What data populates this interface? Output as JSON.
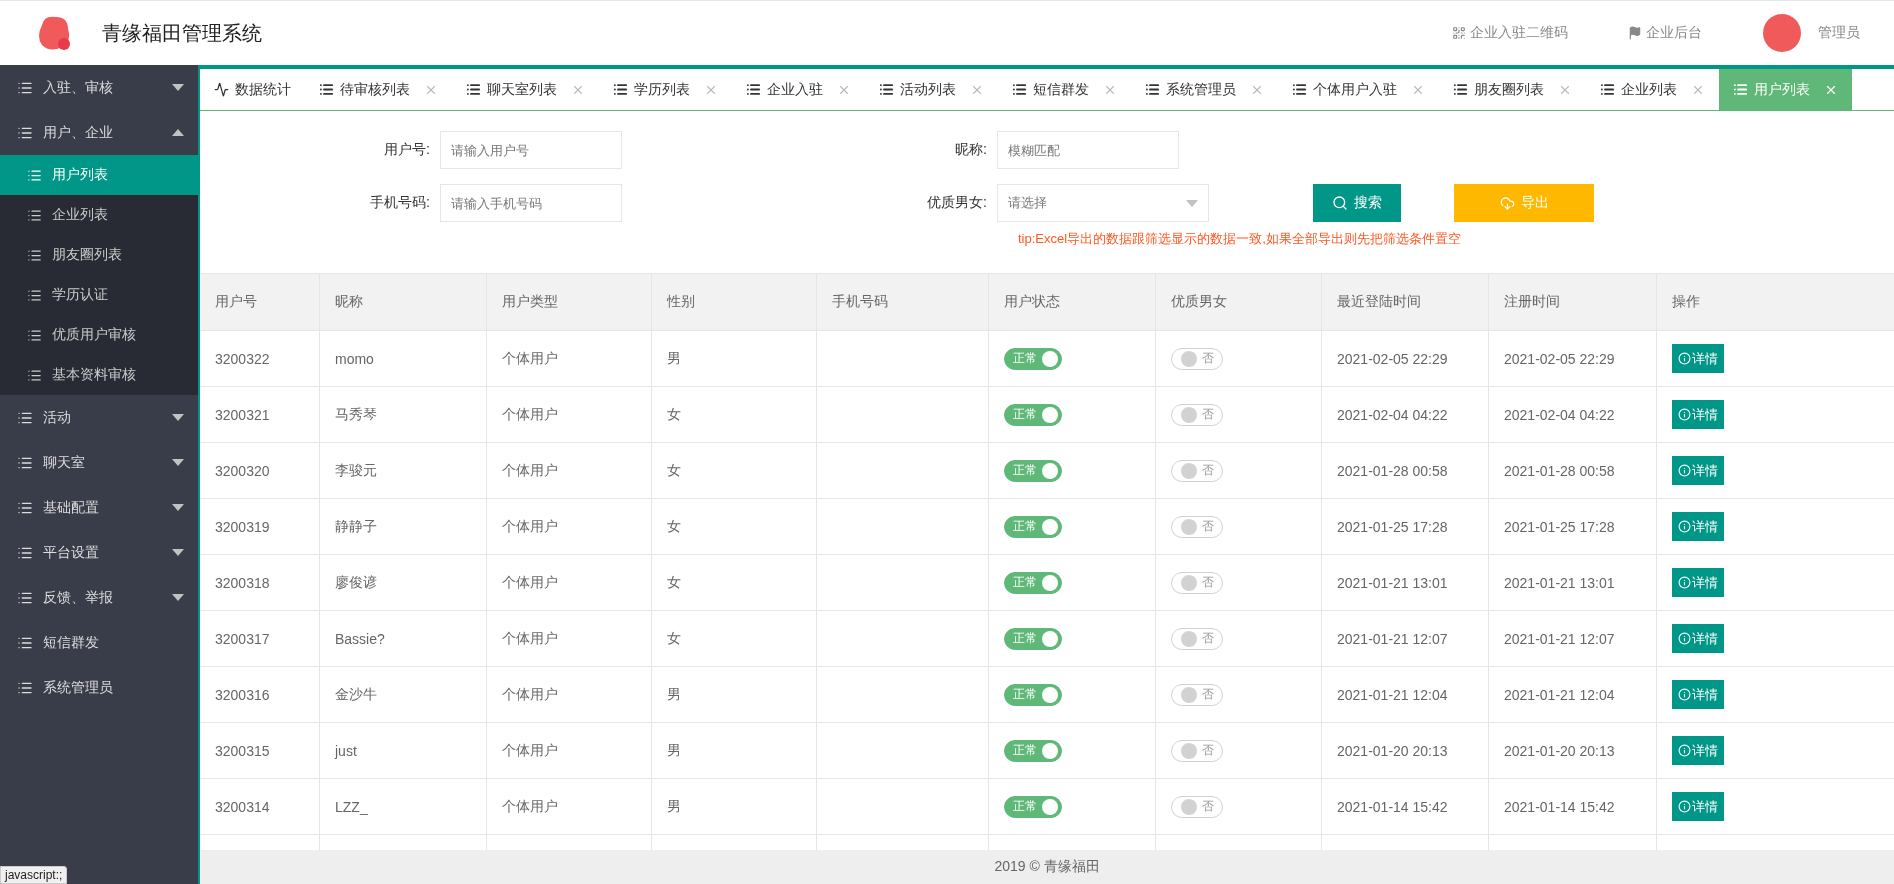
{
  "header": {
    "title": "青缘福田管理系统",
    "links": [
      {
        "label": "企业入驻二维码",
        "kind": "qr"
      },
      {
        "label": "企业后台",
        "kind": "flag"
      }
    ],
    "user": {
      "name": "管理员"
    }
  },
  "sidebar": {
    "items": [
      {
        "label": "入驻、审核",
        "expanded": false
      },
      {
        "label": "用户、企业",
        "expanded": true,
        "children": [
          {
            "label": "用户列表",
            "selected": true
          },
          {
            "label": "企业列表",
            "selected": false
          },
          {
            "label": "朋友圈列表",
            "selected": false
          },
          {
            "label": "学历认证",
            "selected": false
          },
          {
            "label": "优质用户审核",
            "selected": false
          },
          {
            "label": "基本资料审核",
            "selected": false
          }
        ]
      },
      {
        "label": "活动",
        "expanded": false
      },
      {
        "label": "聊天室",
        "expanded": false
      },
      {
        "label": "基础配置",
        "expanded": false
      },
      {
        "label": "平台设置",
        "expanded": false
      },
      {
        "label": "反馈、举报",
        "expanded": false
      },
      {
        "label": "短信群发"
      },
      {
        "label": "系统管理员"
      }
    ]
  },
  "tabs": [
    {
      "label": "数据统计",
      "kind": "chart",
      "closable": false,
      "selected": false
    },
    {
      "label": "待审核列表",
      "kind": "list",
      "closable": true,
      "selected": false
    },
    {
      "label": "聊天室列表",
      "kind": "list",
      "closable": true,
      "selected": false
    },
    {
      "label": "学历列表",
      "kind": "list",
      "closable": true,
      "selected": false
    },
    {
      "label": "企业入驻",
      "kind": "list",
      "closable": true,
      "selected": false
    },
    {
      "label": "活动列表",
      "kind": "list",
      "closable": true,
      "selected": false
    },
    {
      "label": "短信群发",
      "kind": "list",
      "closable": true,
      "selected": false
    },
    {
      "label": "系统管理员",
      "kind": "list",
      "closable": true,
      "selected": false
    },
    {
      "label": "个体用户入驻",
      "kind": "list",
      "closable": true,
      "selected": false
    },
    {
      "label": "朋友圈列表",
      "kind": "list",
      "closable": true,
      "selected": false
    },
    {
      "label": "企业列表",
      "kind": "list",
      "closable": true,
      "selected": false
    },
    {
      "label": "用户列表",
      "kind": "list",
      "closable": true,
      "selected": true
    }
  ],
  "filters": {
    "rows": [
      [
        {
          "label": "用户号:",
          "kind": "input",
          "placeholder": "请输入用户号"
        },
        {
          "label": "昵称:",
          "kind": "input",
          "placeholder": "模糊匹配"
        }
      ],
      [
        {
          "label": "手机号码:",
          "kind": "input",
          "placeholder": "请输入手机号码"
        },
        {
          "label": "优质男女:",
          "kind": "select",
          "placeholder": "请选择"
        }
      ]
    ],
    "buttons": [
      {
        "label": "搜索",
        "kind": "search"
      },
      {
        "label": "导出",
        "kind": "export"
      }
    ],
    "tip": "tip:Excel导出的数据跟筛选显示的数据一致,如果全部导出则先把筛选条件置空"
  },
  "table": {
    "columns": [
      "用户号",
      "昵称",
      "用户类型",
      "性别",
      "手机号码",
      "用户状态",
      "优质男女",
      "最近登陆时间",
      "注册时间",
      "操作"
    ],
    "rows": [
      {
        "id": "3200322",
        "nickname": "momo",
        "type": "个体用户",
        "gender": "男",
        "status": {
          "label": "正常",
          "on": true
        },
        "premium": {
          "label": "否",
          "on": false
        },
        "last_login": "2021-02-05 22:29",
        "registered": "2021-02-05 22:29",
        "action": "详情"
      },
      {
        "id": "3200321",
        "nickname": "马秀琴",
        "type": "个体用户",
        "gender": "女",
        "status": {
          "label": "正常",
          "on": true
        },
        "premium": {
          "label": "否",
          "on": false
        },
        "last_login": "2021-02-04 04:22",
        "registered": "2021-02-04 04:22",
        "action": "详情"
      },
      {
        "id": "3200320",
        "nickname": "李骏元",
        "type": "个体用户",
        "gender": "女",
        "status": {
          "label": "正常",
          "on": true
        },
        "premium": {
          "label": "否",
          "on": false
        },
        "last_login": "2021-01-28 00:58",
        "registered": "2021-01-28 00:58",
        "action": "详情"
      },
      {
        "id": "3200319",
        "nickname": "静静子",
        "type": "个体用户",
        "gender": "女",
        "status": {
          "label": "正常",
          "on": true
        },
        "premium": {
          "label": "否",
          "on": false
        },
        "last_login": "2021-01-25 17:28",
        "registered": "2021-01-25 17:28",
        "action": "详情"
      },
      {
        "id": "3200318",
        "nickname": "廖俊谚",
        "type": "个体用户",
        "gender": "女",
        "status": {
          "label": "正常",
          "on": true
        },
        "premium": {
          "label": "否",
          "on": false
        },
        "last_login": "2021-01-21 13:01",
        "registered": "2021-01-21 13:01",
        "action": "详情"
      },
      {
        "id": "3200317",
        "nickname": "Bassie?",
        "type": "个体用户",
        "gender": "女",
        "status": {
          "label": "正常",
          "on": true
        },
        "premium": {
          "label": "否",
          "on": false
        },
        "last_login": "2021-01-21 12:07",
        "registered": "2021-01-21 12:07",
        "action": "详情"
      },
      {
        "id": "3200316",
        "nickname": "金沙牛",
        "type": "个体用户",
        "gender": "男",
        "status": {
          "label": "正常",
          "on": true
        },
        "premium": {
          "label": "否",
          "on": false
        },
        "last_login": "2021-01-21 12:04",
        "registered": "2021-01-21 12:04",
        "action": "详情"
      },
      {
        "id": "3200315",
        "nickname": "just",
        "type": "个体用户",
        "gender": "男",
        "status": {
          "label": "正常",
          "on": true
        },
        "premium": {
          "label": "否",
          "on": false
        },
        "last_login": "2021-01-20 20:13",
        "registered": "2021-01-20 20:13",
        "action": "详情"
      },
      {
        "id": "3200314",
        "nickname": "LZZ_",
        "type": "个体用户",
        "gender": "男",
        "status": {
          "label": "正常",
          "on": true
        },
        "premium": {
          "label": "否",
          "on": false
        },
        "last_login": "2021-01-14 15:42",
        "registered": "2021-01-14 15:42",
        "action": "详情"
      }
    ]
  },
  "footer": "2019 © 青缘福田",
  "status_bar": "javascript:;"
}
